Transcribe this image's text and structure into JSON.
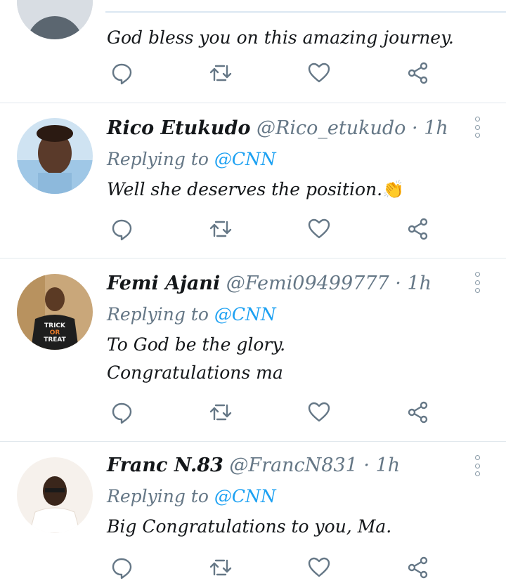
{
  "tweets": [
    {
      "name": "",
      "handle": "",
      "time": "",
      "text": "God bless you on this amazing journey."
    },
    {
      "name": "Rico Etukudo",
      "handle": "@Rico_etukudo",
      "time": "1h",
      "replying_prefix": "Replying to",
      "mention": "@CNN",
      "text": "Well she deserves the position.",
      "emoji": "👏"
    },
    {
      "name": "Femi Ajani",
      "handle": "@Femi09499777",
      "time": "1h",
      "replying_prefix": "Replying to",
      "mention": "@CNN",
      "text_line1": "To God be the glory.",
      "text_line2": "Congratulations ma",
      "shirt_text": "TRICK OR TREAT"
    },
    {
      "name": "Franc N.83",
      "handle": "@FrancN831",
      "time": "1h",
      "replying_prefix": "Replying to",
      "mention": "@CNN",
      "text": "Big Congratulations to you, Ma."
    }
  ],
  "separator": "·",
  "icons": [
    "reply-icon",
    "retweet-icon",
    "like-icon",
    "share-icon",
    "more-options-icon"
  ],
  "colors": {
    "text": "#14171a",
    "secondary": "#657786",
    "accent": "#1da1f2",
    "divider": "#e1e8ed"
  }
}
